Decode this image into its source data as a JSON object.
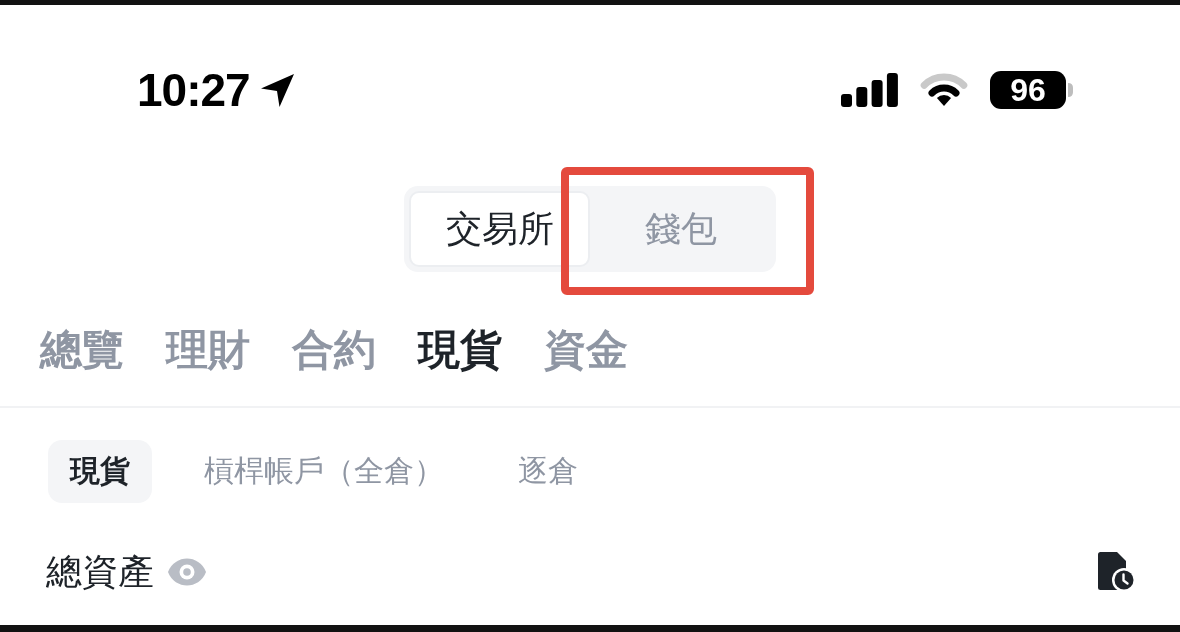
{
  "status_bar": {
    "time": "10:27",
    "battery": "96"
  },
  "mode_switch": [
    {
      "label": "交易所",
      "selected": true,
      "highlighted": false
    },
    {
      "label": "錢包",
      "selected": false,
      "highlighted": true
    }
  ],
  "tabs": [
    {
      "label": "總覽",
      "selected": false
    },
    {
      "label": "理財",
      "selected": false
    },
    {
      "label": "合約",
      "selected": false
    },
    {
      "label": "現貨",
      "selected": true
    },
    {
      "label": "資金",
      "selected": false
    }
  ],
  "account_tabs": [
    {
      "label": "現貨",
      "selected": true
    },
    {
      "label": "槓桿帳戶（全倉）",
      "selected": false
    },
    {
      "label": "逐倉",
      "selected": false
    }
  ],
  "total_assets": {
    "label": "總資產"
  }
}
